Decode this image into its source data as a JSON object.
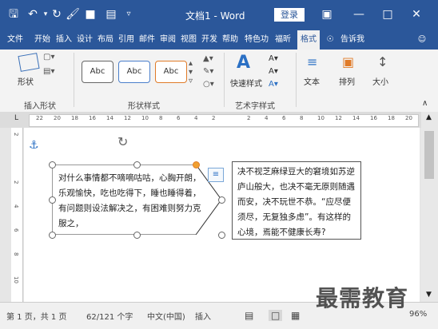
{
  "titlebar": {
    "doc_title": "文档1 - Word",
    "login_label": "登录",
    "icons": [
      "save-icon",
      "undo-icon",
      "redo-icon",
      "format-painter-icon",
      "clear-format-icon",
      "customize-icon",
      "ribbon-display-icon",
      "minimize-icon",
      "maximize-icon",
      "close-icon"
    ]
  },
  "tabs": [
    "文件",
    "开始",
    "插入",
    "设计",
    "布局",
    "引用",
    "邮件",
    "审阅",
    "视图",
    "开发",
    "帮助",
    "特色功",
    "福昕",
    "格式",
    "告诉我"
  ],
  "ribbon": {
    "shape_btn": "形状",
    "insert_shape_group": "插入形状",
    "shape_style_group": "形状样式",
    "style_abc": [
      "Abc",
      "Abc",
      "Abc"
    ],
    "quick_style": "快速样式",
    "art_group": "艺术字样式",
    "text_btn": "文本",
    "arrange_btn": "排列",
    "size_btn": "大小"
  },
  "ruler": {
    "ticks": [
      "22",
      "20",
      "18",
      "16",
      "14",
      "12",
      "10",
      "8",
      "6",
      "4",
      "2",
      "",
      "2",
      "4",
      "6",
      "8",
      "10",
      "12",
      "14",
      "16",
      "18",
      "20"
    ]
  },
  "vruler": {
    "ticks": [
      "2",
      "",
      "2",
      "4",
      "6",
      "8",
      "10"
    ]
  },
  "document": {
    "left_text": "对什么事情都不嘀嘀咕咕，心胸开朗，乐观愉快，吃也吃得下，睡也睡得着，有问题则设法解决之，有困难则努力克服之，",
    "right_text": "决不视芝麻绿豆大的窘境如苏逆庐山般大，也决不毫无原则随遇而安，决不玩世不恭。“应尽便须尽，无复独多虑”。有这样的心境，焉能不健康长寿?"
  },
  "status": {
    "page": "第 1 页，共 1 页",
    "words": "62/121 个字",
    "lang": "中文(中国)",
    "mode": "插入",
    "zoom": "96%"
  },
  "watermark": "最需教育"
}
